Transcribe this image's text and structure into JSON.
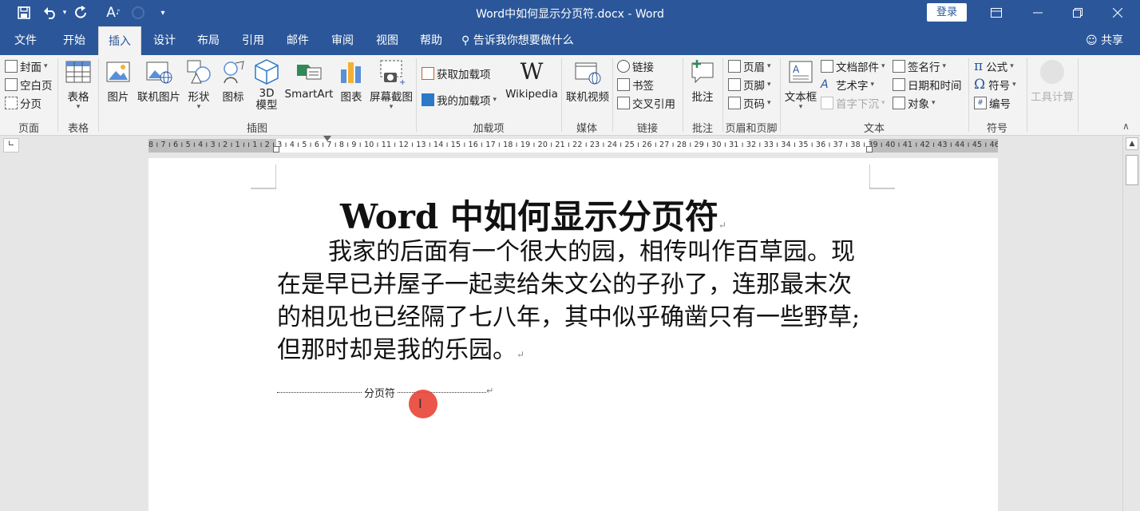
{
  "window": {
    "title": "Word中如何显示分页符.docx  -  Word",
    "login_label": "登录",
    "share_label": "共享"
  },
  "quick_access": [
    "save-icon",
    "undo-icon",
    "redo-icon",
    "font-icon",
    "circle-icon",
    "customize-icon"
  ],
  "tabs": [
    "文件",
    "开始",
    "插入",
    "设计",
    "布局",
    "引用",
    "邮件",
    "审阅",
    "视图",
    "帮助"
  ],
  "active_tab": "插入",
  "tell_me": "告诉我你想要做什么",
  "ribbon": {
    "pages": {
      "cover": "封面",
      "blank": "空白页",
      "break": "分页",
      "label": "页面"
    },
    "tables": {
      "table": "表格",
      "label": "表格"
    },
    "illustrations": {
      "picture": "图片",
      "online_picture": "联机图片",
      "shapes": "形状",
      "icons": "图标",
      "model_3d_line1": "3D",
      "model_3d_line2": "模型",
      "smartart": "SmartArt",
      "chart": "图表",
      "screenshot": "屏幕截图",
      "label": "插图"
    },
    "addins": {
      "get": "获取加载项",
      "mine": "我的加载项",
      "wikipedia": "Wikipedia",
      "label": "加载项"
    },
    "media": {
      "online_video": "联机视频",
      "label": "媒体"
    },
    "links": {
      "link": "链接",
      "bookmark": "书签",
      "cross_ref": "交叉引用",
      "label": "链接"
    },
    "comments": {
      "comment": "批注",
      "label": "批注"
    },
    "header_footer": {
      "header": "页眉",
      "footer": "页脚",
      "page_number": "页码",
      "label": "页眉和页脚"
    },
    "text": {
      "textbox": "文本框",
      "quick_parts": "文档部件",
      "wordart": "艺术字",
      "dropcap": "首字下沉",
      "signature": "签名行",
      "datetime": "日期和时间",
      "object": "对象",
      "label": "文本"
    },
    "symbols": {
      "equation": "公式",
      "symbol": "符号",
      "number": "编号",
      "label": "符号"
    },
    "tools": {
      "calc": "工具计算"
    }
  },
  "ruler_text": "8 ı 7 ı 6 ı 5 ı 4 ı 3 ı 2 ı 1 ı     ı 1 ı 2 ı 3 ı 4 ı 5 ı 6 ı 7 ı 8 ı 9 ı 10 ı 11 ı 12 ı 13 ı 14 ı 15 ı 16 ı 17 ı 18 ı 19 ı 20 ı 21 ı 22 ı 23 ı 24 ı 25 ı 26 ı 27 ı 28 ı 29 ı 30 ı 31 ı 32 ı 33 ı 34 ı 35 ı 36 ı 37 ı 38 ı 39 ı 40 ı 41 ı 42 ı 43 ı 44 ı 45 ı 46 ı 47 ı 48",
  "document": {
    "title": "Word 中如何显示分页符",
    "body": "我家的后面有一个很大的园，相传叫作百草园。现在是早已并屋子一起卖给朱文公的子孙了，连那最末次的相见也已经隔了七八年，其中似乎确凿只有一些野草;但那时却是我的乐园。",
    "page_break_label": "分页符",
    "para_mark": "↵"
  }
}
